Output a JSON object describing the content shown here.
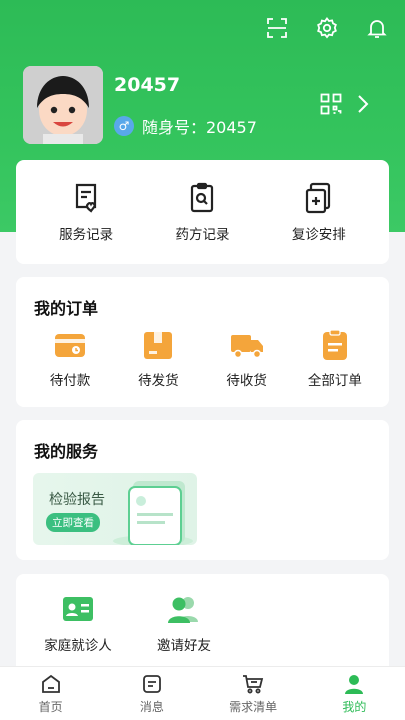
{
  "profile": {
    "username": "20457",
    "id_label": "随身号：20457",
    "gender_symbol": "♂"
  },
  "icons": {
    "scan": "scan-icon",
    "settings": "gear-icon",
    "notifications": "bell-icon",
    "qr": "qrcode-icon",
    "chevron": "chevron-right-icon"
  },
  "quick_actions": [
    {
      "label": "服务记录",
      "icon": "service-record-icon"
    },
    {
      "label": "药方记录",
      "icon": "prescription-record-icon"
    },
    {
      "label": "复诊安排",
      "icon": "revisit-schedule-icon"
    }
  ],
  "orders": {
    "title": "我的订单",
    "items": [
      {
        "label": "待付款",
        "icon": "wallet-icon"
      },
      {
        "label": "待发货",
        "icon": "package-icon"
      },
      {
        "label": "待收货",
        "icon": "truck-icon"
      },
      {
        "label": "全部订单",
        "icon": "clipboard-icon"
      }
    ]
  },
  "services": {
    "title": "我的服务",
    "report": {
      "title": "检验报告",
      "button": "立即查看"
    }
  },
  "family": {
    "items": [
      {
        "label": "家庭就诊人",
        "icon": "id-card-icon"
      },
      {
        "label": "邀请好友",
        "icon": "users-icon"
      }
    ]
  },
  "tabbar": [
    {
      "label": "首页",
      "icon": "home-icon"
    },
    {
      "label": "消息",
      "icon": "message-icon"
    },
    {
      "label": "需求清单",
      "icon": "cart-icon"
    },
    {
      "label": "我的",
      "icon": "person-icon",
      "active": true
    }
  ],
  "colors": {
    "brand": "#2dbb56",
    "orange": "#f4a53b"
  }
}
